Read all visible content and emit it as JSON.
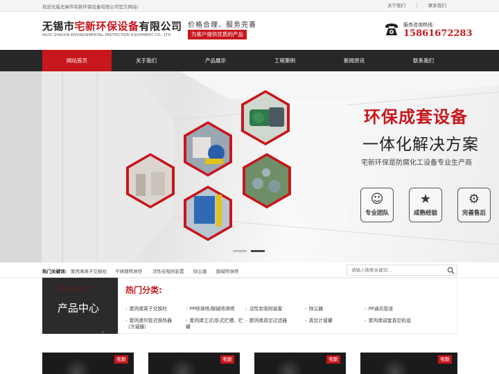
{
  "topbar": {
    "welcome": "欢迎光临无锡市宅新环保设备有限公司官方网站!",
    "links": [
      "关于我们",
      "联系我们"
    ]
  },
  "header": {
    "logo_prefix": "无锡市",
    "logo_brand": "宅新环保设备",
    "logo_suffix": "有限公司",
    "logo_en": "WUXI ZHAIXIN ENVIRONMENTAL PROTECTION EQUIPMENT CO., LTD",
    "slogan_main": "价格合理、服务完善",
    "slogan_badge": "为客户提供优质的产品",
    "hotline_label": "服务咨询热线:",
    "hotline_number": "15861672283"
  },
  "nav": {
    "items": [
      "网站首页",
      "关于我们",
      "产品展示",
      "工程案例",
      "新闻资讯",
      "联系我们"
    ],
    "active_index": 0
  },
  "banner": {
    "title_red": "环保成套设备",
    "title_black": "一体化解决方案",
    "subtitle": "宅新环保是防腐化工设备专业生产商",
    "features": [
      {
        "icon": "team-icon",
        "label": "专业团队"
      },
      {
        "icon": "medal-icon",
        "label": "成熟经验"
      },
      {
        "icon": "service-icon",
        "label": "完善售后"
      }
    ],
    "slides": 2,
    "active_slide": 1
  },
  "search": {
    "hot_label": "热门关键词:",
    "keywords": [
      "聚丙烯离子交换柱",
      "不锈钢喷淋塔",
      "活性炭吸附装置",
      "除尘器",
      "酸碱喷淋塔"
    ],
    "placeholder": "请输入搜索关键词..."
  },
  "products": {
    "en_title": "PRODUCT",
    "cn_title": "产品中心",
    "arrow": "›",
    "category_title": "热门分类:",
    "categories": [
      "聚丙烯离子交换柱",
      "PP喷淋塔/酸碱喷淋塔",
      "活性炭吸附装置",
      "除尘器",
      "PP通风管道",
      "聚丙烯列管式换热器（冷凝器）",
      "聚丙烯立式/卧式贮槽、贮罐",
      "聚丙烯真空过滤器",
      "真空计量罐",
      "聚丙烯成套真空机组"
    ]
  },
  "thumbnails": [
    {
      "tag": "宅新"
    },
    {
      "tag": "宅新"
    },
    {
      "tag": "宅新"
    },
    {
      "tag": "宅新"
    }
  ],
  "colors": {
    "brand_red": "#c8161d",
    "nav_dark": "#272727",
    "product_dark": "#2b2b2b"
  }
}
